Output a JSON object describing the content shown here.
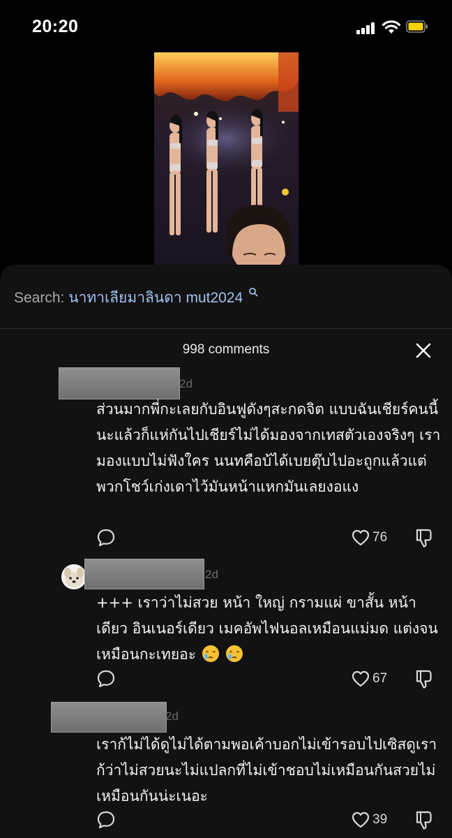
{
  "status_bar": {
    "time": "20:20"
  },
  "search": {
    "label": "Search:",
    "query": "นาทาเลียมาลินดา mut2024"
  },
  "comments_header": {
    "count_text": "998 comments"
  },
  "comments": [
    {
      "age": "2d",
      "text": "ส่วนมากพี่กะเลยกับอินฟูดังๆสะกดจิต แบบฉันเชียร์คนนี้นะแล้วก็แห่กันไปเชียร์ไม่ได้มองจากเทสตัวเองจริงๆ เรามองแบบไม่ฟังใคร นนทคือบ้ได้เบยตุ๊บไปอะถูกแล้วแต่พวกโชว์เก่งเดาไว้มันหน้าแหกมันเลยงอแง",
      "likes": "76"
    },
    {
      "age": "2d",
      "text": "+++ เราว่าไม่สวย หน้า ใหญ่ กรามแผ่ ขาสั้น หน้าเดียว อินเนอร์เดียว เมคอัพไฟนอลเหมือนแม่มด แต่งจนเหมือนกะเทยอะ",
      "likes": "67"
    },
    {
      "age": "2d",
      "text": "เราก้ไม่ได้ดูไม่ได้ตามพอเค้าบอกไม่เข้ารอบไปเซิสดูเราก้ว่าไม่สวยนะไม่แปลกที่ไม่เข้าชอบไม่เหมือนกันสวยไม่เหมือนกันน่ะเนอะ",
      "likes": "39"
    }
  ],
  "colors": {
    "sheet_bg": "#121212",
    "search_query": "#9fc2ee",
    "battery": "#f4d20a"
  },
  "icons": [
    "signal-icon",
    "wifi-icon",
    "battery-icon",
    "search-icon",
    "close-icon",
    "reply-icon",
    "heart-icon",
    "dislike-icon"
  ]
}
